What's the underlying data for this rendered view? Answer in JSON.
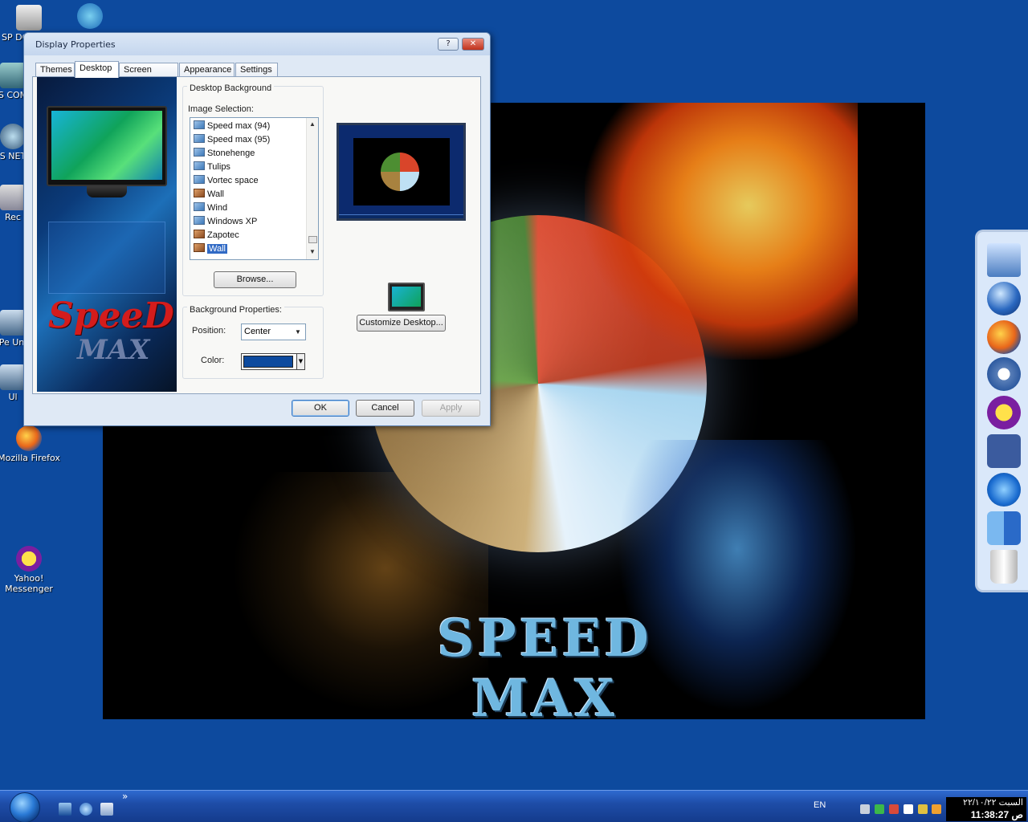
{
  "desktop": {
    "background_color": "#0d4a9e",
    "wallpaper_text": "SPEED MAX",
    "icons": [
      {
        "label": "SP DOC",
        "icon": "printer-icon"
      },
      {
        "label": "",
        "icon": "shortcut-icon"
      },
      {
        "label": "S COM",
        "icon": "computer-icon"
      },
      {
        "label": "S NET",
        "icon": "network-icon"
      },
      {
        "label": "Rec",
        "icon": "recycle-icon"
      },
      {
        "label": "Pe Uni",
        "icon": "app-icon"
      },
      {
        "label": "Ul",
        "icon": "app-icon"
      },
      {
        "label": "Mozilla Firefox",
        "icon": "firefox-icon"
      },
      {
        "label": "Yahoo! Messenger",
        "icon": "yahoo-messenger-icon"
      }
    ]
  },
  "dialog": {
    "title": "Display Properties",
    "help_label": "?",
    "close_label": "✕",
    "tabs": [
      {
        "label": "Themes"
      },
      {
        "label": "Desktop"
      },
      {
        "label": "Screen Saver"
      },
      {
        "label": "Appearance"
      },
      {
        "label": "Settings"
      }
    ],
    "active_tab": "Desktop",
    "preview_art_text": {
      "top": "SpeeD",
      "bottom": "MAX"
    },
    "desktop_background": {
      "group_title": "Desktop Background",
      "image_selection_label": "Image Selection:",
      "images": [
        {
          "name": "Speed max (94)",
          "icon": "image-icon"
        },
        {
          "name": "Speed max (95)",
          "icon": "image-icon"
        },
        {
          "name": "Stonehenge",
          "icon": "image-icon"
        },
        {
          "name": "Tulips",
          "icon": "image-icon"
        },
        {
          "name": "Vortec space",
          "icon": "image-icon"
        },
        {
          "name": "Wall",
          "icon": "wall-image-icon"
        },
        {
          "name": "Wind",
          "icon": "image-icon"
        },
        {
          "name": "Windows XP",
          "icon": "image-icon"
        },
        {
          "name": "Zapotec",
          "icon": "wall-image-icon"
        },
        {
          "name": "Wall",
          "icon": "wall-image-icon",
          "selected": true
        }
      ],
      "browse_label": "Browse..."
    },
    "customize_label": "Customize Desktop...",
    "background_properties": {
      "group_title": "Background Properties:",
      "position_label": "Position:",
      "position_value": "Center",
      "color_label": "Color:",
      "color_value": "#0d4a9e"
    },
    "buttons": {
      "ok": "OK",
      "cancel": "Cancel",
      "apply": "Apply"
    }
  },
  "dock": {
    "items": [
      {
        "icon": "computer-icon"
      },
      {
        "icon": "globe-icon"
      },
      {
        "icon": "firefox-icon"
      },
      {
        "icon": "settings-gear-icon"
      },
      {
        "icon": "yahoo-messenger-icon"
      },
      {
        "icon": "facebook-icon"
      },
      {
        "icon": "internet-explorer-icon"
      },
      {
        "icon": "finder-icon"
      },
      {
        "icon": "trash-icon"
      }
    ]
  },
  "taskbar": {
    "chevron": "»",
    "language": "EN",
    "clock_date": "السبت ٢٢/١٠/٢٢",
    "clock_time": "11:38:27 ص"
  }
}
